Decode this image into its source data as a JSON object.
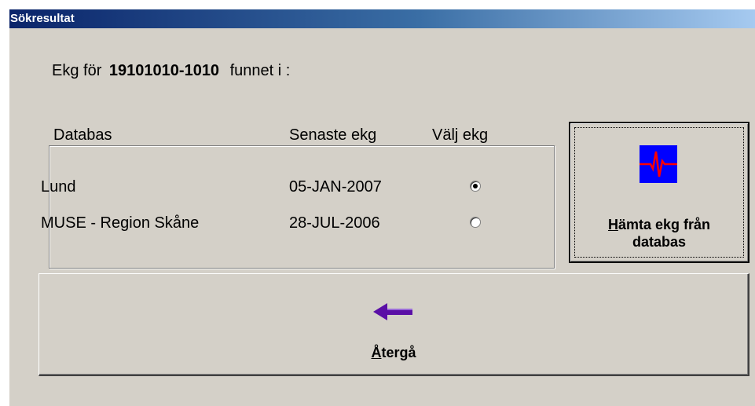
{
  "window": {
    "title": "Sökresultat"
  },
  "heading": {
    "prefix": "Ekg för",
    "personnummer": "19101010-1010",
    "suffix": "funnet i :"
  },
  "table": {
    "columns": {
      "database": "Databas",
      "latest_ekg": "Senaste ekg",
      "select": "Välj ekg"
    },
    "rows": [
      {
        "database": "Lund",
        "latest_ekg": "05-JAN-2007",
        "selected": true
      },
      {
        "database": "MUSE - Region Skåne",
        "latest_ekg": "28-JUL-2006",
        "selected": false
      }
    ]
  },
  "fetch_button": {
    "label_mnemonic": "H",
    "label_rest_line1": "ämta ekg från",
    "label_line2": "databas",
    "icon": "ecg-heartbeat-icon"
  },
  "back_button": {
    "label_mnemonic": "Å",
    "label_rest": "tergå",
    "icon": "left-arrow-icon"
  },
  "colors": {
    "dialog_bg": "#d4d0c8",
    "title_gradient_start": "#0a246a",
    "title_gradient_end": "#a6caf0",
    "ecg_icon_bg": "#0000ff",
    "ecg_trace": "#ff0000",
    "arrow": "#5a0fa6"
  }
}
